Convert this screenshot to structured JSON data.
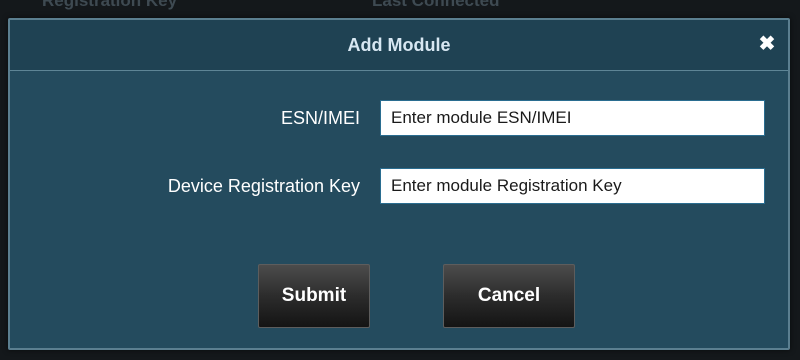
{
  "background": {
    "columns": [
      "Registration Key",
      "Last Connected"
    ]
  },
  "modal": {
    "title": "Add Module",
    "close_glyph": "✖",
    "fields": [
      {
        "label": "ESN/IMEI",
        "placeholder": "Enter module ESN/IMEI",
        "value": ""
      },
      {
        "label": "Device Registration Key",
        "placeholder": "Enter module Registration Key",
        "value": ""
      }
    ],
    "buttons": {
      "submit_label": "Submit",
      "cancel_label": "Cancel"
    }
  },
  "colors": {
    "dialog_bg": "#244b5e",
    "header_bg": "#1f4253",
    "title_text": "#d7e7f2",
    "input_border": "#2a6d90",
    "button_dark": "#2c2c2c"
  }
}
